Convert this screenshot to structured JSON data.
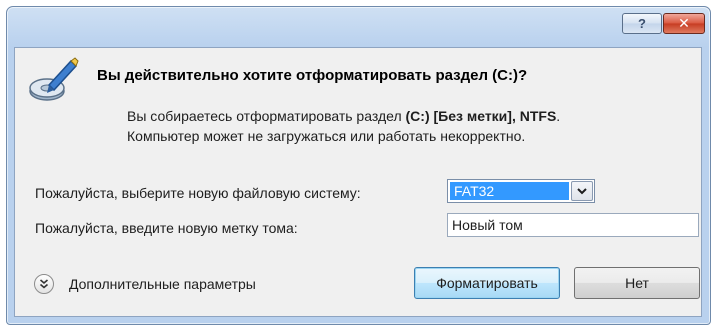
{
  "titlebar": {
    "help_label": "?",
    "close_label": "✕"
  },
  "dialog": {
    "question": "Вы действительно хотите отформатировать раздел (C:)?",
    "desc_line1_prefix": "Вы собираетесь отформатировать раздел ",
    "desc_line1_bold": "(C:) [Без метки]",
    "desc_line1_sep": ", ",
    "desc_line1_fs": "NTFS",
    "desc_line1_end": ".",
    "desc_line2": "Компьютер может не загружаться или работать некорректно."
  },
  "form": {
    "fs_label": "Пожалуйста, выберите новую файловую систему:",
    "fs_value": "FAT32",
    "volume_label": "Пожалуйста, введите новую метку тома:",
    "volume_value": "Новый том"
  },
  "footer": {
    "advanced_label": "Дополнительные параметры",
    "format_button": "Форматировать",
    "no_button": "Нет"
  },
  "icons": {
    "app": "disk-format-icon",
    "advanced": "expand-chevrons-icon",
    "dropdown": "chevron-down-icon"
  },
  "colors": {
    "selection": "#3399ff",
    "close_button": "#c63c22",
    "title_gradient": "#b9d1ee"
  }
}
